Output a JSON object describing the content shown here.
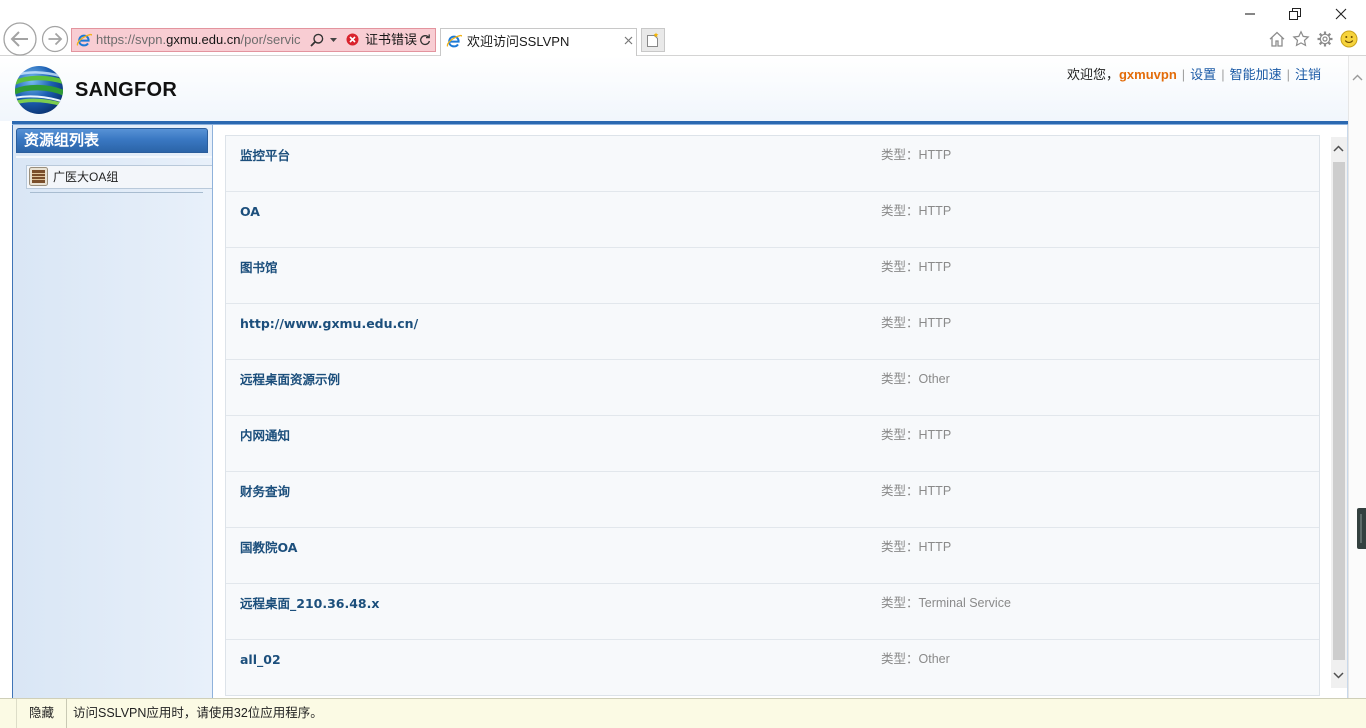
{
  "browser": {
    "url_prefix": "https://svpn.",
    "url_domain": "gxmu.edu.cn",
    "url_path": "/por/servic",
    "cert_error": "证书错误",
    "tab_title": "欢迎访问SSLVPN"
  },
  "header": {
    "logo_text": "SANGFOR",
    "welcome": "欢迎您，",
    "username": "gxmuvpn",
    "separator": "|",
    "links": {
      "settings": "设置",
      "acceleration": "智能加速",
      "logout": "注销"
    }
  },
  "sidebar": {
    "title": "资源组列表",
    "groups": [
      {
        "label": "广医大OA组",
        "icon": "resource-group-icon"
      }
    ]
  },
  "resources": {
    "type_prefix": "类型：",
    "items": [
      {
        "name": "监控平台",
        "type": "HTTP"
      },
      {
        "name": "OA",
        "type": "HTTP"
      },
      {
        "name": "图书馆",
        "type": "HTTP"
      },
      {
        "name": "http://www.gxmu.edu.cn/",
        "type": "HTTP"
      },
      {
        "name": "远程桌面资源示例",
        "type": "Other"
      },
      {
        "name": "内网通知",
        "type": "HTTP"
      },
      {
        "name": "财务查询",
        "type": "HTTP"
      },
      {
        "name": "国教院OA",
        "type": "HTTP"
      },
      {
        "name": "远程桌面_210.36.48.x",
        "type": "Terminal Service"
      },
      {
        "name": "all_02",
        "type": "Other"
      }
    ]
  },
  "footer": {
    "hide_label": "隐藏",
    "notice": "访问SSLVPN应用时，请使用32位应用程序。"
  },
  "colors": {
    "accent": "#2b69b1",
    "sidebar_header": "#3a78c2",
    "username": "#e36c0a",
    "link": "#1b5aa6",
    "resource_name": "#1c4f7c",
    "type_text": "#8a8a8a",
    "cert_error_bg": "#f8cdd3",
    "notice_bar_bg": "#fbfae4"
  }
}
